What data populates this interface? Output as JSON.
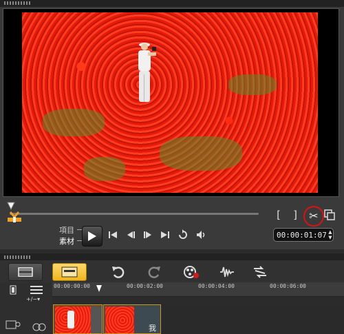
{
  "player": {
    "mode_project": "項目",
    "mode_clip": "素材",
    "timecode": "00:00:01:07",
    "bracket_in": "[",
    "bracket_out": "]",
    "icons": [
      "scissors-icon",
      "copy-icon",
      "play-icon",
      "skip-start-icon",
      "prev-frame-icon",
      "next-frame-icon",
      "skip-end-icon",
      "repeat-icon",
      "volume-icon"
    ]
  },
  "toolbar": {
    "add_remove": "+/−▾",
    "icons": [
      "film-storyboard-icon",
      "timeline-view-icon",
      "undo-icon",
      "redo-icon",
      "record-capture-icon",
      "audio-mix-icon",
      "auto-music-icon"
    ]
  },
  "timeline": {
    "ticks": [
      "00:00:00:00",
      "00:00:02:00",
      "00:00:04:00",
      "00:00:06:00"
    ],
    "clip2_text": "我"
  },
  "colors": {
    "accent_yellow": "#f0b51c",
    "highlight_red": "#e01010",
    "background": "#3a3a3a"
  }
}
